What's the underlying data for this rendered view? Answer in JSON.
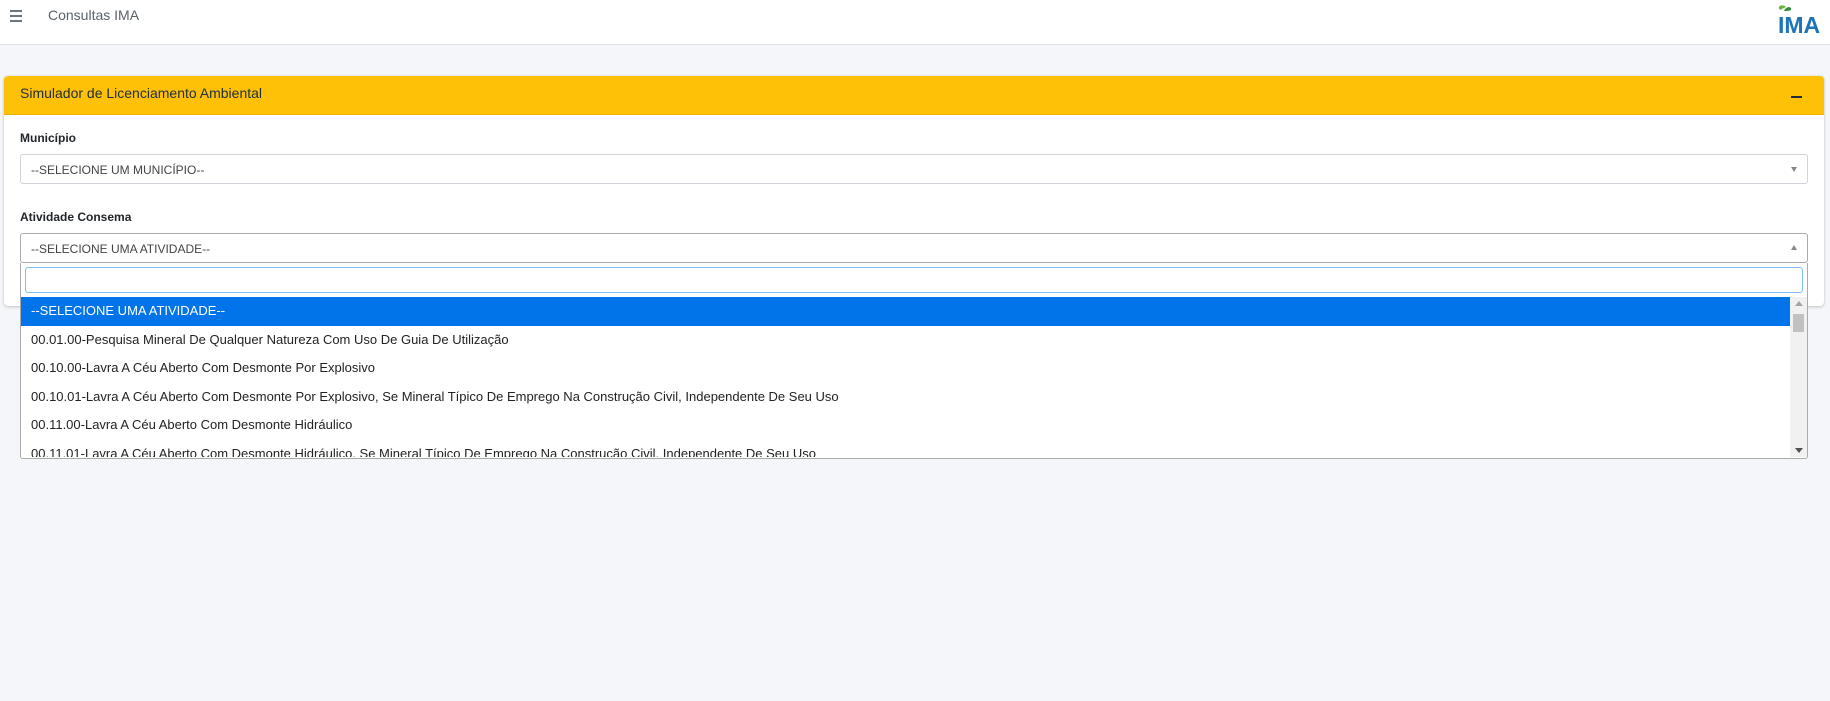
{
  "header": {
    "app_title": "Consultas IMA",
    "logo_text": "IMA"
  },
  "card": {
    "title": "Simulador de Licenciamento Ambiental",
    "header_color": "#ffc107"
  },
  "municipio": {
    "label": "Município",
    "selected": "--SELECIONE UM MUNICÍPIO--"
  },
  "atividade": {
    "label": "Atividade Consema",
    "selected": "--SELECIONE UMA ATIVIDADE--",
    "search_value": "",
    "options": [
      "--SELECIONE UMA ATIVIDADE--",
      "00.01.00-Pesquisa Mineral De Qualquer Natureza Com Uso De Guia De Utilização",
      "00.10.00-Lavra A Céu Aberto Com Desmonte Por Explosivo",
      "00.10.01-Lavra A Céu Aberto Com Desmonte Por Explosivo, Se Mineral Típico De Emprego Na Construção Civil, Independente De Seu Uso",
      "00.11.00-Lavra A Céu Aberto Com Desmonte Hidráulico",
      "00.11.01-Lavra A Céu Aberto Com Desmonte Hidráulico, Se Mineral Típico De Emprego Na Construção Civil, Independente De Seu Uso"
    ],
    "highlight_color": "#0074e8"
  }
}
